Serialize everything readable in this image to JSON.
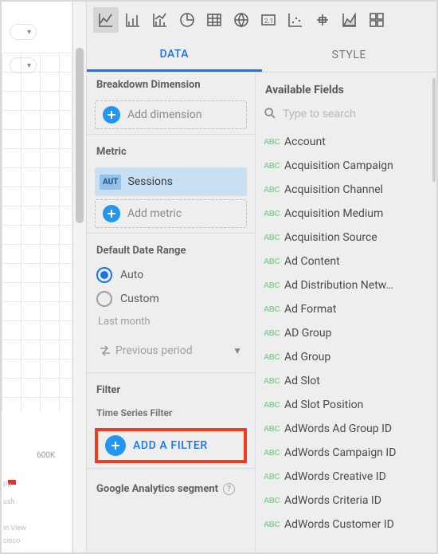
{
  "canvas": {
    "tick_label": "600K",
    "snips": [
      "Pu",
      "ush",
      "in View",
      "cisco"
    ]
  },
  "tabs": {
    "data": "DATA",
    "style": "STYLE"
  },
  "breakdown": {
    "title": "Breakdown Dimension",
    "add_label": "Add dimension"
  },
  "metric": {
    "title": "Metric",
    "tag": "AUT",
    "value": "Sessions",
    "add_label": "Add metric"
  },
  "date_range": {
    "title": "Default Date Range",
    "auto": "Auto",
    "custom": "Custom",
    "last": "Last month",
    "compare": "Previous period"
  },
  "filter": {
    "title": "Filter",
    "subtitle": "Time Series Filter",
    "add_label": "ADD A FILTER"
  },
  "ga_segment": {
    "title": "Google Analytics segment"
  },
  "fields": {
    "title": "Available Fields",
    "search_placeholder": "Type to search",
    "items": [
      "Account",
      "Acquisition Campaign",
      "Acquisition Channel",
      "Acquisition Medium",
      "Acquisition Source",
      "Ad Content",
      "Ad Distribution Netw…",
      "Ad Format",
      "AD Group",
      "Ad Group",
      "Ad Slot",
      "Ad Slot Position",
      "AdWords Ad Group ID",
      "AdWords Campaign ID",
      "AdWords Creative ID",
      "AdWords Criteria ID",
      "AdWords Customer ID"
    ]
  }
}
